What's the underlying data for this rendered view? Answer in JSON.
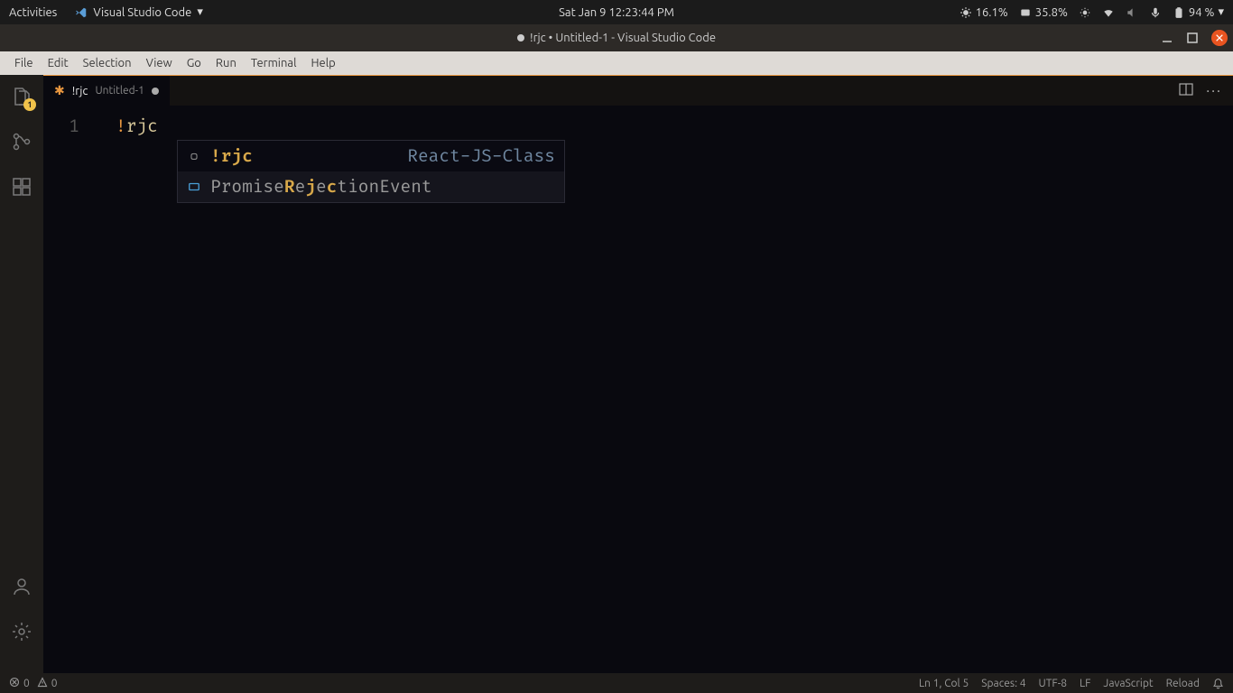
{
  "gnome": {
    "activities": "Activities",
    "app_name": "Visual Studio Code",
    "datetime": "Sat Jan 9  12:23:44 PM",
    "cpu": "16.1%",
    "mem": "35.8%",
    "battery": "94 %"
  },
  "window": {
    "title": "!rjc • Untitled-1 - Visual Studio Code"
  },
  "menu": {
    "items": [
      "File",
      "Edit",
      "Selection",
      "View",
      "Go",
      "Run",
      "Terminal",
      "Help"
    ]
  },
  "activity": {
    "explorer_badge": "1"
  },
  "tab": {
    "name": "!rjc",
    "desc": "Untitled-1"
  },
  "editor": {
    "line_number": "1",
    "code_bang": "!",
    "code_text": "rjc"
  },
  "suggest": [
    {
      "label_pre": "!",
      "label_hl": "rjc",
      "label_post": "",
      "detail": "React-JS-Class",
      "kind": "snippet"
    },
    {
      "label_pre": "Promise",
      "label_hl": "R",
      "label_mid": "e",
      "label_hl2": "j",
      "label_mid2": "e",
      "label_hl3": "c",
      "label_post": "tionEvent",
      "detail": "",
      "kind": "variable"
    }
  ],
  "status": {
    "errors": "0",
    "warnings": "0",
    "cursor": "Ln 1, Col 5",
    "indent": "Spaces: 4",
    "encoding": "UTF-8",
    "eol": "LF",
    "lang": "JavaScript",
    "reload": "Reload"
  }
}
